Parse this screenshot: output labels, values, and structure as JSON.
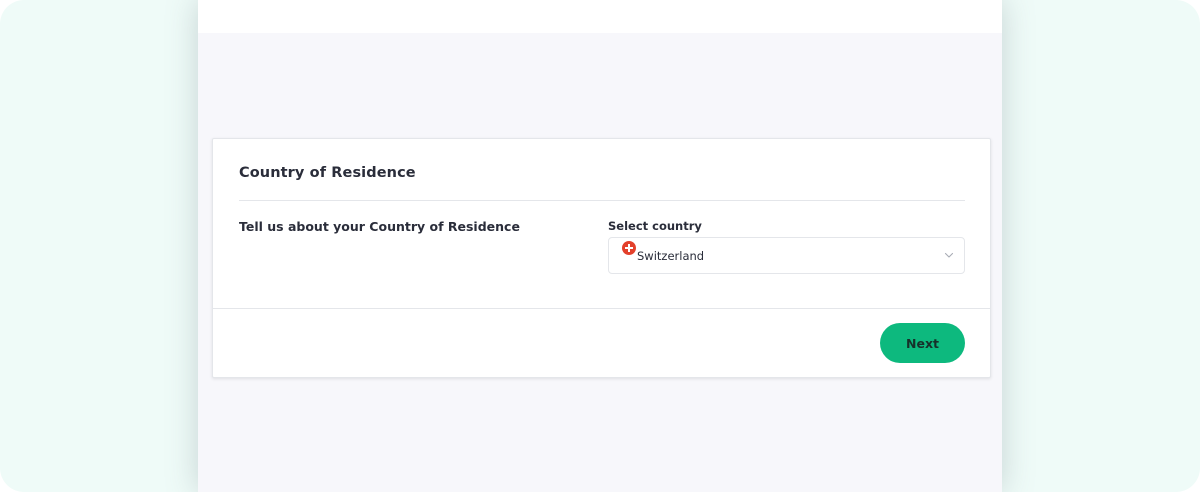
{
  "card": {
    "title": "Country of Residence",
    "section_label": "Tell us about your Country of Residence"
  },
  "country_select": {
    "label": "Select country",
    "value": "Switzerland",
    "flag_icon": "switzerland-flag-icon",
    "dropdown_icon": "chevron-down-icon"
  },
  "actions": {
    "next_label": "Next"
  },
  "colors": {
    "outer_background": "#effbf8",
    "page_background": "#f7f7fb",
    "primary_button": "#0db97e",
    "flag_red": "#e3402b"
  }
}
